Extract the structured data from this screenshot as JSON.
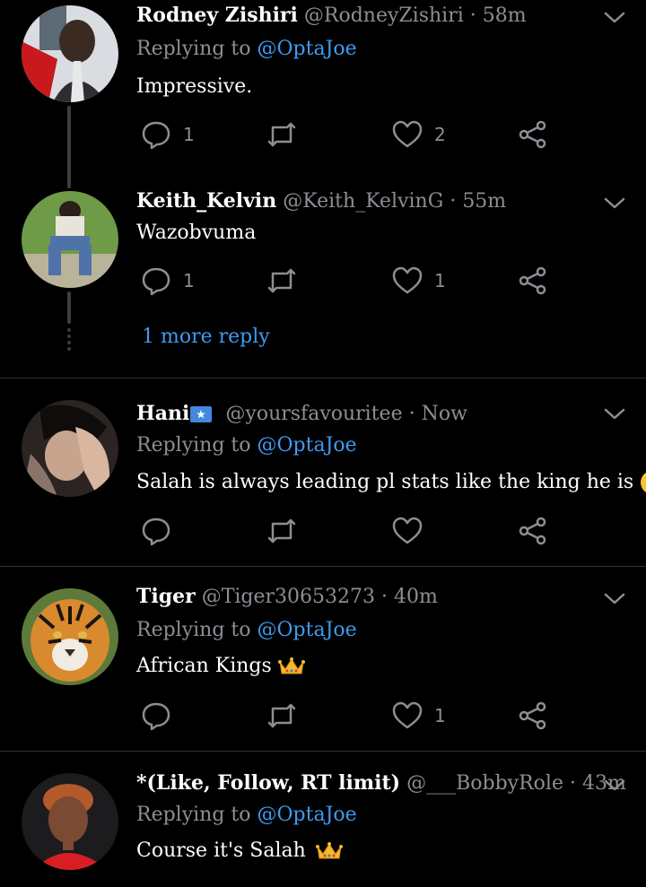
{
  "tweets": [
    {
      "name": "Rodney Zishiri",
      "handle": "@RodneyZishiri",
      "time": "58m",
      "reply_label": "Replying to",
      "reply_handle": "@OptaJoe",
      "text": "Impressive.",
      "replies": "1",
      "retweets": "",
      "likes": "2"
    },
    {
      "name": "Keith_Kelvin",
      "handle": "@Keith_KelvinG",
      "time": "55m",
      "text": "Wazobvuma",
      "replies": "1",
      "retweets": "",
      "likes": "1",
      "more_replies": "1 more reply"
    },
    {
      "name": "Hani",
      "handle": "@yoursfavouritee",
      "time": "Now",
      "reply_label": "Replying to",
      "reply_handle": "@OptaJoe",
      "text": "Salah is always leading pl stats like the king he is",
      "replies": "",
      "retweets": "",
      "likes": ""
    },
    {
      "name": "Tiger",
      "handle": "@Tiger30653273",
      "time": "40m",
      "reply_label": "Replying to",
      "reply_handle": "@OptaJoe",
      "text": "African Kings",
      "replies": "",
      "retweets": "",
      "likes": "1"
    },
    {
      "name": "*(Like, Follow, RT limit)",
      "handle": "@___BobbyRole",
      "time": "43m",
      "reply_label": "Replying to",
      "reply_handle": "@OptaJoe",
      "text": "Course it's Salah"
    }
  ],
  "separator": "·",
  "colors": {
    "background": "#000000",
    "link": "#3e9bf0",
    "muted": "#8b8f94",
    "divider": "#2f3336"
  }
}
